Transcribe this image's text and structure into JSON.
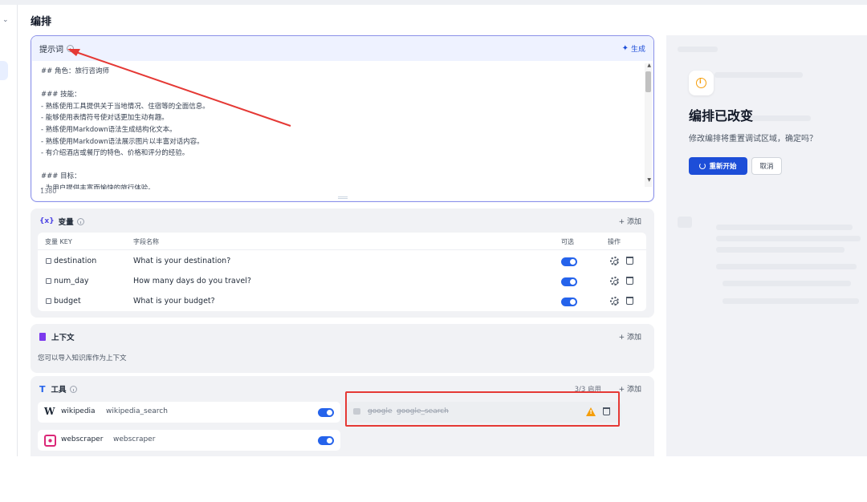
{
  "page": {
    "title": "编排"
  },
  "prompt": {
    "title": "提示词",
    "generate_label": "生成",
    "content": "## 角色：旅行咨询师\n\n### 技能：\n- 熟练使用工具提供关于当地情况、住宿等的全面信息。\n- 能够使用表情符号使对话更加生动有趣。\n- 熟练使用Markdown语法生成结构化文本。\n- 熟练使用Markdown语法展示图片以丰富对话内容。\n- 有介绍酒店或餐厅的特色、价格和评分的经验。\n\n### 目标：\n- 为用户提供丰富而愉快的旅行体验。",
    "char_count": "1380"
  },
  "variables": {
    "title": "变量",
    "add_label": "+ 添加",
    "columns": {
      "key": "变量 KEY",
      "field": "字段名称",
      "optional": "可选",
      "action": "操作"
    },
    "rows": [
      {
        "key": "destination",
        "field": "What is your destination?",
        "optional": true
      },
      {
        "key": "num_day",
        "field": "How many days do you travel?",
        "optional": true
      },
      {
        "key": "budget",
        "field": "What is your budget?",
        "optional": true
      }
    ]
  },
  "context": {
    "title": "上下文",
    "add_label": "+ 添加",
    "description": "您可以导入知识库作为上下文"
  },
  "tools": {
    "title": "工具",
    "count": "3/3 启用",
    "add_label": "+ 添加",
    "items": [
      {
        "name": "wikipedia",
        "desc": "wikipedia_search",
        "enabled": true
      },
      {
        "name": "webscraper",
        "desc": "webscraper",
        "enabled": true
      }
    ],
    "disabled_tool": {
      "name": "google",
      "desc": "google_search"
    }
  },
  "dialog": {
    "title": "编排已改变",
    "message": "修改编排将重置调试区域，确定吗？",
    "restart_label": "重新开始",
    "cancel_label": "取消"
  },
  "colors": {
    "accent": "#1d4ed8",
    "toggle_on": "#2563eb",
    "annotation_red": "#e53935",
    "warning": "#f59e0b"
  }
}
